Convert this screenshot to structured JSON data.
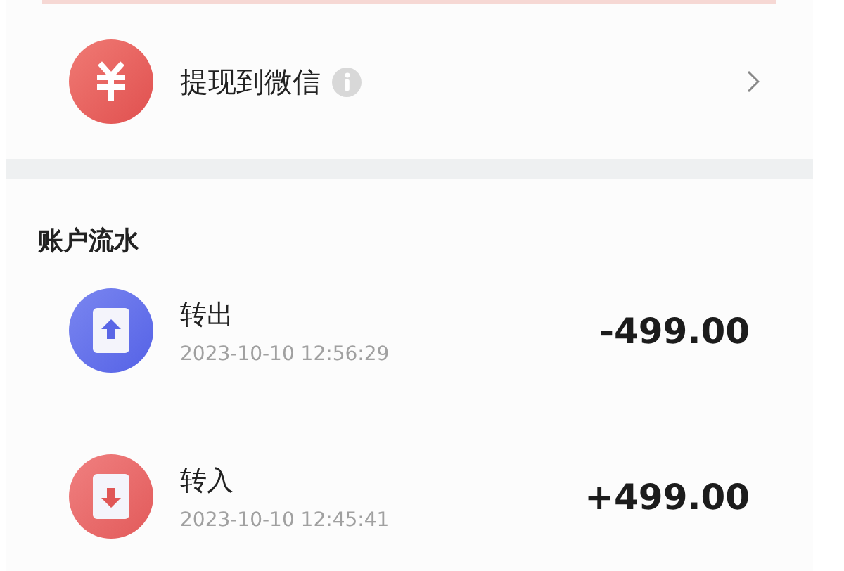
{
  "withdraw": {
    "label": "提现到微信"
  },
  "ledger": {
    "title": "账户流水",
    "transactions": [
      {
        "kind": "out",
        "title": "转出",
        "time": "2023-10-10 12:56:29",
        "amount": "-499.00"
      },
      {
        "kind": "in",
        "title": "转入",
        "time": "2023-10-10 12:45:41",
        "amount": "+499.00"
      }
    ]
  }
}
